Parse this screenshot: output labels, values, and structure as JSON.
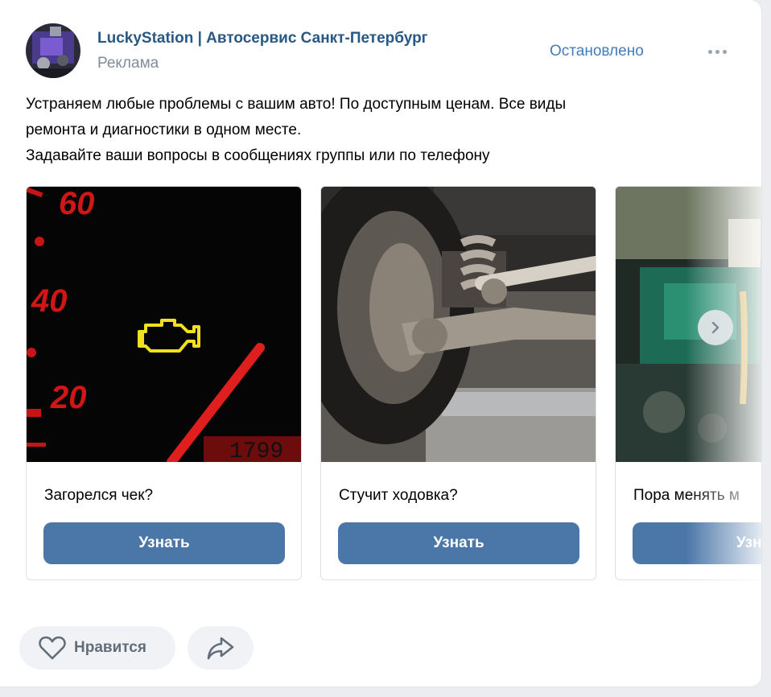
{
  "post": {
    "author": "LuckyStation | Автосервис Санкт-Петербург",
    "ad_label": "Реклама",
    "status": "Остановлено",
    "text_lines": [
      "Устраняем любые проблемы с вашим авто! По доступным ценам. Все виды",
      "ремонта и диагностики в одном месте.",
      "Задавайте ваши вопросы в сообщениях группы или по телефону"
    ]
  },
  "carousel": {
    "cards": [
      {
        "title": "Загорелся чек?",
        "button": "Узнать",
        "image": "dashboard-check-engine"
      },
      {
        "title": "Стучит ходовка?",
        "button": "Узнать",
        "image": "car-suspension"
      },
      {
        "title": "Пора менять м",
        "button": "Узна",
        "image": "engine-oil-pour"
      }
    ],
    "next_icon": "chevron-right-icon"
  },
  "dashboard": {
    "speed_marks": [
      "60",
      "40",
      "20"
    ],
    "odometer": "1799"
  },
  "actions": {
    "like_label": "Нравится",
    "like_icon": "heart-icon",
    "share_icon": "share-icon"
  },
  "colors": {
    "brand_link": "#2a5885",
    "button_bg": "#4a76a8",
    "muted": "#818c99",
    "status": "#447bba"
  }
}
